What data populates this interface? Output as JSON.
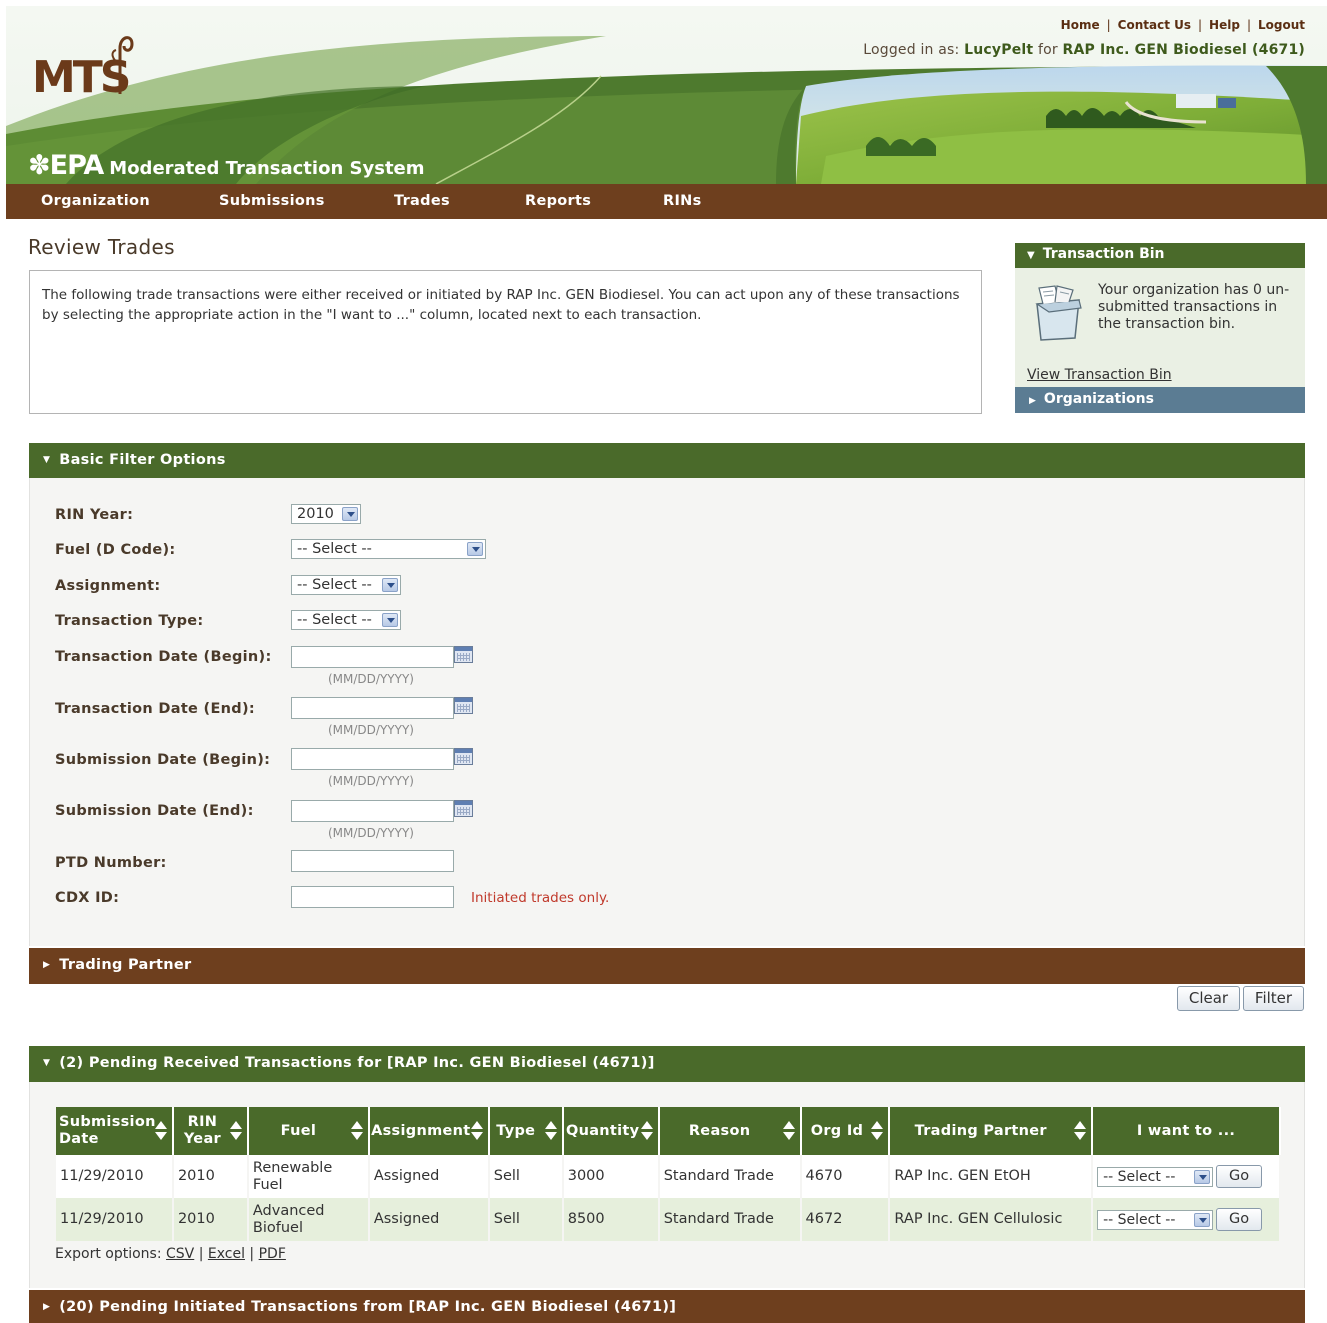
{
  "header": {
    "top_links": [
      "Home",
      "Contact Us",
      "Help",
      "Logout"
    ],
    "logged_in_prefix": "Logged in as:",
    "logged_in_user": "LucyPelt",
    "logged_in_for": "for",
    "logged_in_org": "RAP Inc. GEN Biodiesel (4671)",
    "logo_text": "MTS",
    "epa_text": "EPA",
    "system_title": "Moderated Transaction System"
  },
  "nav": [
    "Organization",
    "Submissions",
    "Trades",
    "Reports",
    "RINs"
  ],
  "page": {
    "title": "Review Trades",
    "intro": "The following trade transactions were either received or initiated by RAP Inc. GEN Biodiesel. You can act upon any of these transactions by selecting the appropriate action in the \"I want to ...\" column, located next to each transaction."
  },
  "transaction_bin": {
    "title": "Transaction Bin",
    "message": "Your organization has 0 un-submitted transactions in the transaction bin.",
    "link": "View Transaction Bin",
    "organizations_label": "Organizations"
  },
  "filter": {
    "title": "Basic Filter Options",
    "rin_year_label": "RIN Year:",
    "rin_year_value": "2010",
    "fuel_label": "Fuel (D Code):",
    "fuel_value": "-- Select --",
    "assignment_label": "Assignment:",
    "assignment_value": "-- Select --",
    "transaction_type_label": "Transaction Type:",
    "transaction_type_value": "-- Select --",
    "tx_begin_label": "Transaction Date (Begin):",
    "tx_end_label": "Transaction Date (End):",
    "sub_begin_label": "Submission Date (Begin):",
    "sub_end_label": "Submission Date (End):",
    "date_hint": "(MM/DD/YYYY)",
    "ptd_label": "PTD Number:",
    "cdx_label": "CDX ID:",
    "cdx_note": "Initiated trades only.",
    "trading_partner_title": "Trading Partner",
    "clear_label": "Clear",
    "filter_label": "Filter"
  },
  "received": {
    "title": "(2) Pending Received Transactions for [RAP Inc. GEN Biodiesel (4671)]",
    "columns": [
      "Submission Date",
      "RIN Year",
      "Fuel",
      "Assignment",
      "Type",
      "Quantity",
      "Reason",
      "Org Id",
      "Trading Partner",
      "I want to ..."
    ],
    "rows": [
      [
        "11/29/2010",
        "2010",
        "Renewable Fuel",
        "Assigned",
        "Sell",
        "3000",
        "Standard Trade",
        "4670",
        "RAP Inc. GEN EtOH"
      ],
      [
        "11/29/2010",
        "2010",
        "Advanced Biofuel",
        "Assigned",
        "Sell",
        "8500",
        "Standard Trade",
        "4672",
        "RAP Inc. GEN Cellulosic"
      ]
    ],
    "action_select": "-- Select --",
    "go_label": "Go",
    "export_label": "Export options:",
    "export_links": [
      "CSV",
      "Excel",
      "PDF"
    ]
  },
  "initiated": {
    "title": "(20) Pending Initiated Transactions from [RAP Inc. GEN Biodiesel (4671)]"
  }
}
